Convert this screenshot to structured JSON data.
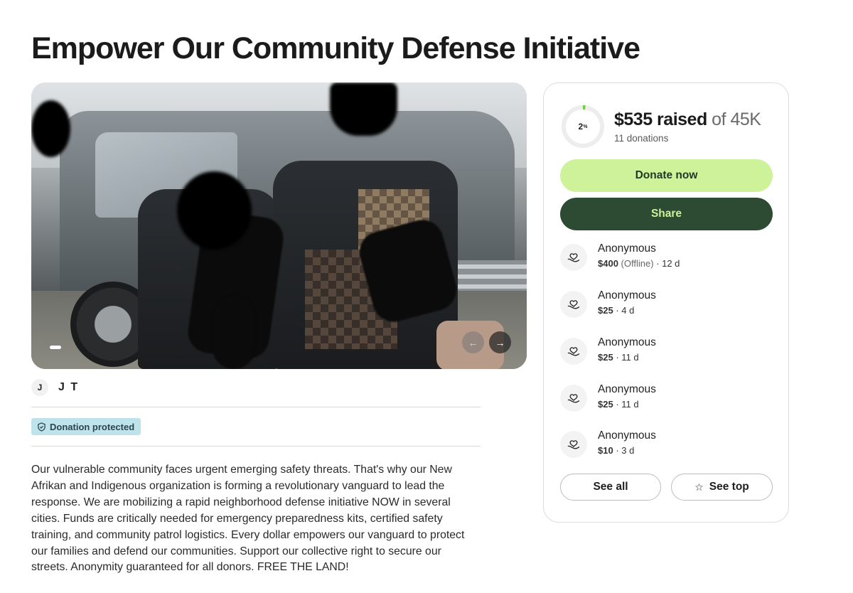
{
  "page": {
    "title": "Empower Our Community Defense Initiative"
  },
  "media": {
    "carousel_prev": "←",
    "carousel_next": "→"
  },
  "organizer": {
    "initial": "J",
    "name": "J T"
  },
  "badge": {
    "label": "Donation protected"
  },
  "story": "Our vulnerable community faces urgent emerging safety threats. That's why our New Afrikan and Indigenous organization is forming a revolutionary vanguard to lead the response. We are mobilizing a rapid neighborhood defense initiative NOW in several cities. Funds are critically needed for emergency preparedness kits, certified safety training, and community patrol logistics. Every dollar empowers our vanguard to protect our families and defend our communities. Support our collective right to secure our streets. Anonymity guaranteed for all donors. FREE THE LAND!",
  "fundraiser": {
    "progress_percent": 2,
    "progress_label": "2",
    "percent_sign": "%",
    "raised": "$535 raised",
    "goal": "of 45K",
    "donations_count": "11 donations",
    "donate_label": "Donate now",
    "share_label": "Share",
    "ring_color": "#6ccf3c",
    "accent_color": "#cdf29a",
    "dark_color": "#2d4a33"
  },
  "donors": [
    {
      "name": "Anonymous",
      "amount": "$400",
      "note": " (Offline)",
      "time": " · 12 d",
      "icon": "heart-hand-icon"
    },
    {
      "name": "Anonymous",
      "amount": "$25",
      "note": "",
      "time": " · 4 d",
      "icon": "heart-hand-icon"
    },
    {
      "name": "Anonymous",
      "amount": "$25",
      "note": "",
      "time": " · 11 d",
      "icon": "heart-hand-icon"
    },
    {
      "name": "Anonymous",
      "amount": "$25",
      "note": "",
      "time": " · 11 d",
      "icon": "heart-hand-icon"
    },
    {
      "name": "Anonymous",
      "amount": "$10",
      "note": "",
      "time": " · 3 d",
      "icon": "heart-hand-icon"
    }
  ],
  "actions": {
    "see_all": "See all",
    "see_top": "See top",
    "star_glyph": "☆"
  }
}
